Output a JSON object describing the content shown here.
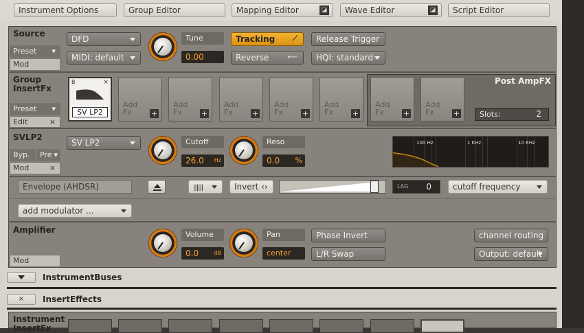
{
  "tabs": [
    "Instrument Options",
    "Group Editor",
    "Mapping Editor",
    "Wave Editor",
    "Script Editor"
  ],
  "source": {
    "title": "Source",
    "preset": "Preset",
    "mod": "Mod",
    "mode": "DFD",
    "midi": "MIDI: default",
    "tune_label": "Tune",
    "tune_value": "0.00",
    "tracking": "Tracking",
    "reverse": "Reverse",
    "release_trigger": "Release Trigger",
    "hqi": "HQI: standard"
  },
  "group_fx": {
    "title_line1": "Group",
    "title_line2": "InsertFx",
    "preset": "Preset",
    "edit": "Edit",
    "close": "×",
    "slot1": "SV LP2",
    "add_line1": "Add",
    "add_line2": "Fx",
    "add_plus": "+",
    "post_title": "Post AmpFX",
    "slots_label": "Slots:",
    "slots_value": "2"
  },
  "svlp2": {
    "title": "SVLP2",
    "byp": "Byp.",
    "pre": "Pre",
    "mod": "Mod",
    "close": "×",
    "type": "SV LP2",
    "cutoff_label": "Cutoff",
    "cutoff_value": "26.0",
    "cutoff_unit": "Hz",
    "reso_label": "Reso",
    "reso_value": "0.0",
    "reso_unit": "%",
    "eq_100": "100 Hz",
    "eq_1k": "1 KHz",
    "eq_10k": "10 KHz"
  },
  "modrow": {
    "envelope": "Envelope (AHDSR)",
    "invert": "Invert ‹›",
    "lag_label": "LAG",
    "lag_value": "0",
    "target": "cutoff frequency",
    "add_mod": "add modulator ...",
    "mod_amount": 0.93
  },
  "amp": {
    "title": "Amplifier",
    "mod": "Mod",
    "volume_label": "Volume",
    "volume_value": "0.0",
    "volume_unit": "dB",
    "pan_label": "Pan",
    "pan_value": "center",
    "phase": "Phase Invert",
    "lrswap": "L/R Swap",
    "routing": "channel routing",
    "output": "Output: default"
  },
  "buses": {
    "label": "InstrumentBuses"
  },
  "insert": {
    "label": "InsertEffects",
    "close": "×",
    "inst_line1": "Instrument",
    "inst_line2": "InsertFx"
  },
  "colors": {
    "accent": "#f5a12a",
    "panel": "#87827b"
  }
}
